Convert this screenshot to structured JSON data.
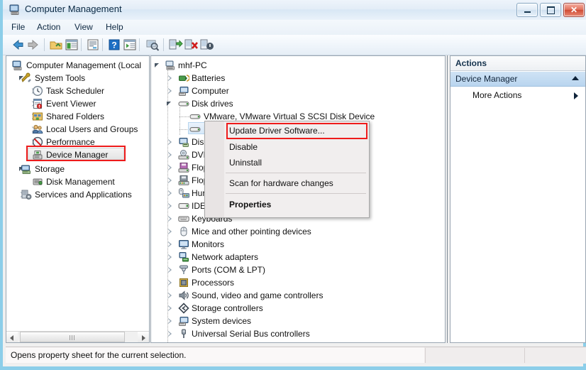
{
  "window": {
    "title": "Computer Management",
    "icon": "computer-management-icon",
    "buttons": {
      "minimize": "Minimize",
      "maximize": "Maximize",
      "close": "Close"
    }
  },
  "menubar": {
    "items": [
      "File",
      "Action",
      "View",
      "Help"
    ]
  },
  "toolbar": {
    "items": [
      "back-icon",
      "forward-icon",
      "up-one-level-icon",
      "show-console-tree-icon",
      "properties-icon",
      "help-icon",
      "show-action-pane-icon",
      "scan-for-hardware-changes-icon",
      "update-driver-software-icon",
      "uninstall-device-icon",
      "disable-device-icon"
    ]
  },
  "console_tree": {
    "root": "Computer Management (Local",
    "items": [
      {
        "label": "Computer Management (Local",
        "icon": "computer-icon",
        "indent": 0,
        "twisty": "none"
      },
      {
        "label": "System Tools",
        "icon": "system-tools-icon",
        "indent": 1,
        "twisty": "expanded"
      },
      {
        "label": "Task Scheduler",
        "icon": "clock-icon",
        "indent": 2,
        "twisty": "collapsed"
      },
      {
        "label": "Event Viewer",
        "icon": "event-viewer-icon",
        "indent": 2,
        "twisty": "collapsed"
      },
      {
        "label": "Shared Folders",
        "icon": "shared-folders-icon",
        "indent": 2,
        "twisty": "collapsed"
      },
      {
        "label": "Local Users and Groups",
        "icon": "users-icon",
        "indent": 2,
        "twisty": "collapsed"
      },
      {
        "label": "Performance",
        "icon": "performance-icon",
        "indent": 2,
        "twisty": "collapsed"
      },
      {
        "label": "Device Manager",
        "icon": "device-manager-icon",
        "indent": 2,
        "twisty": "none"
      },
      {
        "label": "Storage",
        "icon": "storage-icon",
        "indent": 1,
        "twisty": "expanded"
      },
      {
        "label": "Disk Management",
        "icon": "disk-management-icon",
        "indent": 2,
        "twisty": "none"
      },
      {
        "label": "Services and Applications",
        "icon": "services-icon",
        "indent": 1,
        "twisty": "collapsed"
      }
    ],
    "selected": "Device Manager",
    "highlight_color": "#ee1b1b"
  },
  "device_tree": {
    "root": {
      "label": "mhf-PC",
      "icon": "computer-icon",
      "twisty": "expanded"
    },
    "items": [
      {
        "label": "Batteries",
        "icon": "batteries-icon",
        "indent": 1,
        "twisty": "collapsed"
      },
      {
        "label": "Computer",
        "icon": "computer-node-icon",
        "indent": 1,
        "twisty": "collapsed"
      },
      {
        "label": "Disk drives",
        "icon": "disk-drive-icon",
        "indent": 1,
        "twisty": "expanded"
      },
      {
        "label": "VMware, VMware Virtual S SCSI Disk Device",
        "icon": "disk-drive-icon",
        "indent": 2,
        "twisty": "none"
      },
      {
        "label": "",
        "icon": "disk-drive-icon",
        "indent": 2,
        "twisty": "none",
        "selected": true
      },
      {
        "label": "Disp",
        "icon": "display-adapters-icon",
        "indent": 1,
        "twisty": "collapsed",
        "clipped": true
      },
      {
        "label": "DVD",
        "icon": "dvd-cd-rom-icon",
        "indent": 1,
        "twisty": "collapsed",
        "clipped": true
      },
      {
        "label": "Flop",
        "icon": "floppy-disk-drive-icon",
        "indent": 1,
        "twisty": "collapsed",
        "clipped": true
      },
      {
        "label": "Flop",
        "icon": "floppy-controller-icon",
        "indent": 1,
        "twisty": "collapsed",
        "clipped": true
      },
      {
        "label": "Hur",
        "icon": "human-interface-devices-icon",
        "indent": 1,
        "twisty": "collapsed",
        "clipped": true
      },
      {
        "label": "IDE",
        "icon": "ide-controllers-icon",
        "indent": 1,
        "twisty": "collapsed",
        "clipped": true
      },
      {
        "label": "Keyboards",
        "icon": "keyboard-icon",
        "indent": 1,
        "twisty": "collapsed"
      },
      {
        "label": "Mice and other pointing devices",
        "icon": "mouse-icon",
        "indent": 1,
        "twisty": "collapsed"
      },
      {
        "label": "Monitors",
        "icon": "monitor-icon",
        "indent": 1,
        "twisty": "collapsed"
      },
      {
        "label": "Network adapters",
        "icon": "network-adapter-icon",
        "indent": 1,
        "twisty": "collapsed"
      },
      {
        "label": "Ports (COM & LPT)",
        "icon": "ports-icon",
        "indent": 1,
        "twisty": "collapsed"
      },
      {
        "label": "Processors",
        "icon": "processor-icon",
        "indent": 1,
        "twisty": "collapsed"
      },
      {
        "label": "Sound, video and game controllers",
        "icon": "sound-icon",
        "indent": 1,
        "twisty": "collapsed"
      },
      {
        "label": "Storage controllers",
        "icon": "storage-controller-icon",
        "indent": 1,
        "twisty": "collapsed"
      },
      {
        "label": "System devices",
        "icon": "system-devices-icon",
        "indent": 1,
        "twisty": "collapsed"
      },
      {
        "label": "Universal Serial Bus controllers",
        "icon": "usb-controller-icon",
        "indent": 1,
        "twisty": "collapsed"
      }
    ]
  },
  "context_menu": {
    "items": [
      {
        "label": "Update Driver Software...",
        "bold": false,
        "highlighted": true
      },
      {
        "label": "Disable",
        "bold": false
      },
      {
        "label": "Uninstall",
        "bold": false
      },
      {
        "separator": true
      },
      {
        "label": "Scan for hardware changes",
        "bold": false
      },
      {
        "separator": true
      },
      {
        "label": "Properties",
        "bold": true
      }
    ],
    "highlight_color": "#ee1b1b"
  },
  "actions_pane": {
    "header": "Actions",
    "group": "Device Manager",
    "item": "More Actions"
  },
  "statusbar": {
    "text": "Opens property sheet for the current selection."
  }
}
